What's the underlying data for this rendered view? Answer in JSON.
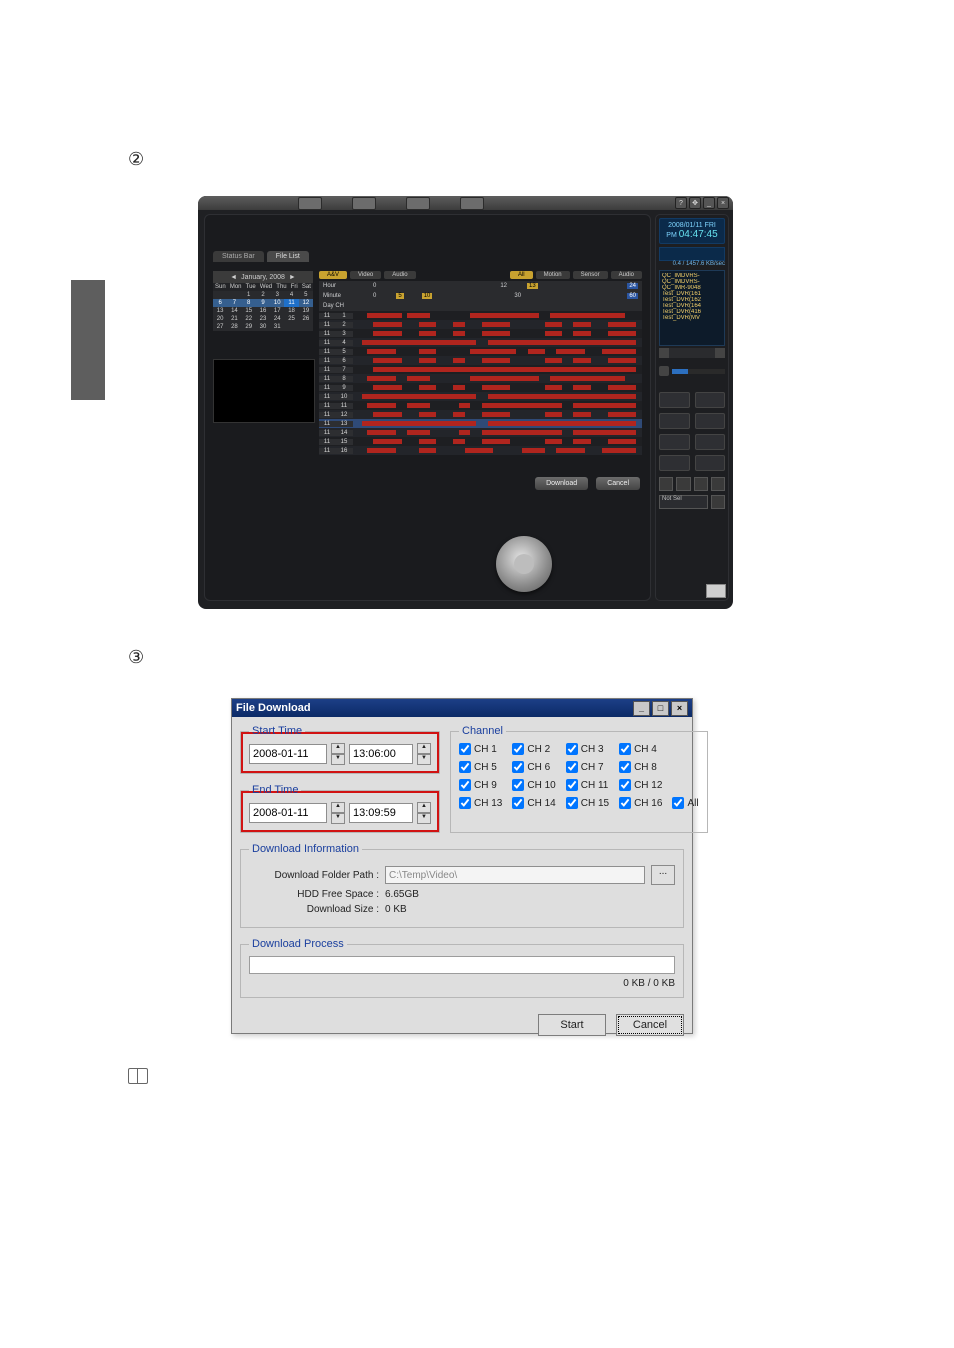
{
  "steps": {
    "s2": "②",
    "s3": "③"
  },
  "shot1": {
    "tabs": {
      "status": "Status Bar",
      "file": "File List"
    },
    "calendar": {
      "title": "January, 2008",
      "week": [
        "Sun",
        "Mon",
        "Tue",
        "Wed",
        "Thu",
        "Fri",
        "Sat"
      ],
      "rows": [
        [
          "",
          "",
          "1",
          "2",
          "3",
          "4",
          "5"
        ],
        [
          "6",
          "7",
          "8",
          "9",
          "10",
          "11",
          "12"
        ],
        [
          "13",
          "14",
          "15",
          "16",
          "17",
          "18",
          "19"
        ],
        [
          "20",
          "21",
          "22",
          "23",
          "24",
          "25",
          "26"
        ],
        [
          "27",
          "28",
          "29",
          "30",
          "31",
          "",
          ""
        ]
      ],
      "highlighted_row": 1,
      "today": "11"
    },
    "timeline": {
      "left_tabs": {
        "av": "A&V",
        "video": "Video",
        "audio": "Audio"
      },
      "right_tabs": {
        "all": "All",
        "motion": "Motion",
        "sensor": "Sensor",
        "audio": "Audio"
      },
      "hour_lbl": "Hour",
      "minute_lbl": "Minute",
      "day_ch_lbl": "Day   CH",
      "hour_marks": {
        "zero": "0",
        "sel_a": "12",
        "sel_b": "13",
        "end": "24"
      },
      "min_marks": {
        "zero": "0",
        "a": "5",
        "b": "10",
        "mid": "30",
        "end": "60"
      },
      "rows": [
        {
          "day": "11",
          "ch": "1"
        },
        {
          "day": "11",
          "ch": "2"
        },
        {
          "day": "11",
          "ch": "3"
        },
        {
          "day": "11",
          "ch": "4"
        },
        {
          "day": "11",
          "ch": "5"
        },
        {
          "day": "11",
          "ch": "6"
        },
        {
          "day": "11",
          "ch": "7"
        },
        {
          "day": "11",
          "ch": "8"
        },
        {
          "day": "11",
          "ch": "9"
        },
        {
          "day": "11",
          "ch": "10"
        },
        {
          "day": "11",
          "ch": "11"
        },
        {
          "day": "11",
          "ch": "12"
        },
        {
          "day": "11",
          "ch": "13"
        },
        {
          "day": "11",
          "ch": "14"
        },
        {
          "day": "11",
          "ch": "15"
        },
        {
          "day": "11",
          "ch": "16"
        }
      ],
      "highlight_ch": "13",
      "download": "Download",
      "cancel": "Cancel"
    },
    "side": {
      "date": "2008/01/11 FRI",
      "time_prefix": "PM",
      "time": "04:47:45",
      "kbsec": "0.4 / 1457.6 KB/sec",
      "devices": [
        "QC_IMDVRS-",
        "QC_IMDVRS-",
        "QC_IMR-9048",
        "Test_DVR(161",
        "Test_DVR(162",
        "Test_DVR(164",
        "Test_DVR(416",
        "Test_DVR(MV"
      ],
      "layout_sel": "Not Sel"
    },
    "winbtns": {
      "help": "?",
      "pin": "✥",
      "min": "_",
      "close": "×"
    }
  },
  "shot2": {
    "title": "File Download",
    "start_legend": "Start Time",
    "end_legend": "End Time",
    "start_date": "2008-01-11",
    "start_time": "13:06:00",
    "end_date": "2008-01-11",
    "end_time": "13:09:59",
    "channel_legend": "Channel",
    "channels": [
      "CH 1",
      "CH 2",
      "CH 3",
      "CH 4",
      "CH 5",
      "CH 6",
      "CH 7",
      "CH 8",
      "CH 9",
      "CH 10",
      "CH 11",
      "CH 12",
      "CH 13",
      "CH 14",
      "CH 15",
      "CH 16",
      "All"
    ],
    "info_legend": "Download Information",
    "path_lbl": "Download Folder Path :",
    "path_val": "C:\\Temp\\Video\\",
    "free_lbl": "HDD Free Space :",
    "free_val": "6.65GB",
    "size_lbl": "Download Size :",
    "size_val": "0 KB",
    "browse": "...",
    "proc_legend": "Download Process",
    "proc_stat": "0 KB / 0 KB",
    "start_btn": "Start",
    "cancel_btn": "Cancel",
    "win": {
      "min": "_",
      "max": "□",
      "close": "×"
    }
  }
}
